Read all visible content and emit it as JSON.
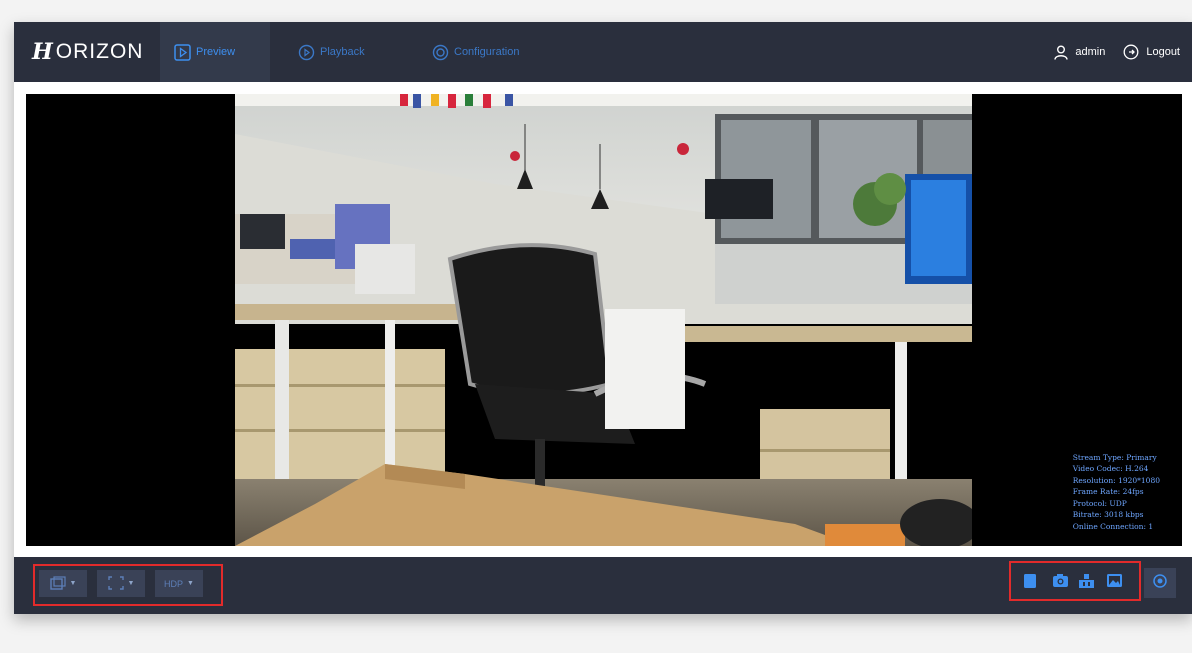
{
  "header": {
    "logo_mark": "H",
    "logo_text": "ORIZON",
    "tabs": [
      {
        "label": "Preview",
        "icon": "play-square-icon",
        "active": true
      },
      {
        "label": "Playback",
        "icon": "replay-circle-icon",
        "active": false
      },
      {
        "label": "Configuration",
        "icon": "config-circle-icon",
        "active": false
      }
    ],
    "user": {
      "name": "admin",
      "icon": "user-icon"
    },
    "logout": {
      "label": "Logout",
      "icon": "logout-icon"
    }
  },
  "video": {
    "osd_lines": [
      "Stream Type: Primary",
      "Video Codec: H.264",
      "Resolution: 1920*1080",
      "Frame Rate: 24fps",
      "Protocol: UDP",
      "Bitrate: 3018 kbps",
      "Online Connection: 1"
    ]
  },
  "toolbar": {
    "left_buttons": [
      {
        "icon": "window-layout-icon"
      },
      {
        "icon": "fullscreen-icon"
      },
      {
        "label": "HDP",
        "icon": "stream-select-icon"
      }
    ],
    "right_buttons": [
      {
        "icon": "record-icon"
      },
      {
        "icon": "snapshot-icon"
      },
      {
        "icon": "ptz-icon"
      },
      {
        "icon": "image-icon"
      },
      {
        "icon": "more-icon"
      }
    ]
  },
  "colors": {
    "header_bg": "#2a2f3d",
    "accent": "#3d8ff0",
    "highlight": "#e22b2b",
    "osd_text": "#6ea6ff"
  }
}
